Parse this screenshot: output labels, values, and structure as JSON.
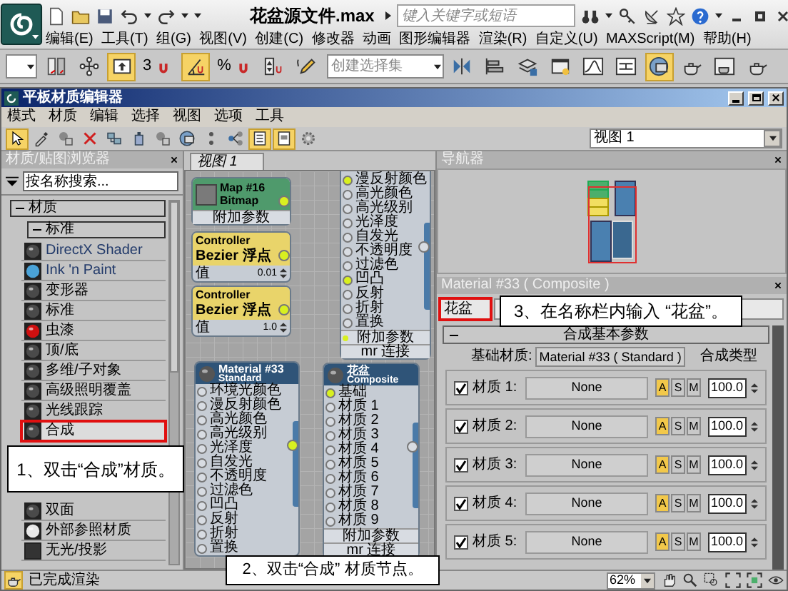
{
  "app_window": {
    "title": "花盆源文件.max",
    "search": {
      "placeholder": "键入关键字或短语"
    }
  },
  "menu": [
    "编辑(E)",
    "工具(T)",
    "组(G)",
    "视图(V)",
    "创建(C)",
    "修改器",
    "动画",
    "图形编辑器",
    "渲染(R)",
    "自定义(U)",
    "MAXScript(M)",
    "帮助(H)"
  ],
  "main_toolbar": {
    "buttons_left": [
      {
        "on": false
      },
      {
        "on": false
      },
      {
        "on": true
      },
      {
        "label": "3",
        "on": false
      },
      {
        "on": true
      },
      {
        "label": "%",
        "on": false
      },
      {
        "on": false
      },
      {
        "on": false
      }
    ],
    "selection_set": {
      "placeholder": "创建选择集"
    },
    "buttons_right": [
      {
        "on": false
      },
      {
        "on": false
      },
      {
        "on": false
      },
      {
        "on": false
      },
      {
        "on": false
      },
      {
        "on": false
      },
      {
        "on": true
      },
      {
        "on": false
      },
      {
        "on": false
      },
      {
        "on": false
      }
    ]
  },
  "editor": {
    "title": "平板材质编辑器",
    "menu": [
      "模式",
      "材质",
      "编辑",
      "选择",
      "视图",
      "选项",
      "工具"
    ],
    "toolbar": [
      {
        "on": true
      },
      {
        "on": false
      },
      {
        "on": false
      },
      {
        "on": false
      },
      {
        "on": false
      },
      {
        "on": false
      },
      {
        "on": false
      },
      {
        "on": false
      },
      {
        "on": false
      },
      {
        "on": false
      },
      {
        "on": true
      },
      {
        "on": true
      },
      {
        "on": false
      }
    ],
    "view_select": {
      "value": "视图 1"
    }
  },
  "browser": {
    "title": "材质/贴图浏览器",
    "search": {
      "placeholder": "按名称搜索..."
    },
    "group": {
      "label": "材质",
      "expanded": true
    },
    "subgroup": {
      "label": "标准",
      "expanded": true
    },
    "items": [
      {
        "label": "DirectX Shader",
        "kind": "sphere",
        "color": "#4a4a4a",
        "selected": false
      },
      {
        "label": "Ink 'n Paint",
        "kind": "disc",
        "color": "#4aa3d8",
        "selected": false
      },
      {
        "label": "变形器",
        "kind": "sphere",
        "color": "#4a4a4a",
        "selected": false
      },
      {
        "label": "标准",
        "kind": "sphere",
        "color": "#4a4a4a",
        "selected": false
      },
      {
        "label": "虫漆",
        "kind": "sphere",
        "color": "#d01010",
        "selected": false
      },
      {
        "label": "顶/底",
        "kind": "sphere",
        "color": "#4a4a4a",
        "selected": false
      },
      {
        "label": "多维/子对象",
        "kind": "sphere",
        "color": "#4a4a4a",
        "selected": false
      },
      {
        "label": "高级照明覆盖",
        "kind": "sphere",
        "color": "#4a4a4a",
        "selected": false
      },
      {
        "label": "光线跟踪",
        "kind": "sphere",
        "color": "#4a4a4a",
        "selected": false
      },
      {
        "label": "合成",
        "kind": "sphere",
        "color": "#4a4a4a",
        "selected": true
      },
      {
        "label": "双面",
        "kind": "sphere",
        "color": "#4a4a4a",
        "selected": false
      },
      {
        "label": "外部参照材质",
        "kind": "sphere",
        "color": "#e8e8e8",
        "selected": false
      },
      {
        "label": "无光/投影",
        "kind": "flat",
        "color": "#333333",
        "selected": false
      }
    ]
  },
  "viewport": {
    "tab": {
      "label": "视图 1",
      "selected": true
    },
    "nodes": [
      {
        "kind": "map",
        "title": "Map #16",
        "subtitle": "Bitmap",
        "footers": [
          "附加参数"
        ]
      },
      {
        "kind": "controller",
        "title": "Controller",
        "subtitle": "Bezier 浮点",
        "value": {
          "label": "值",
          "reading": "0.01"
        }
      },
      {
        "kind": "controller",
        "title": "Controller",
        "subtitle": "Bezier 浮点",
        "value": {
          "label": "值",
          "reading": "1.0"
        }
      },
      {
        "kind": "material",
        "slots": [
          "漫反射颜色",
          "高光颜色",
          "高光级别",
          "光泽度",
          "自发光",
          "不透明度",
          "过滤色",
          "凹凸",
          "反射",
          "折射",
          "置换"
        ],
        "footers": [
          "附加参数",
          "mr 连接"
        ]
      },
      {
        "kind": "material",
        "title": "Material #33",
        "subtitle": "Standard",
        "slots": [
          "环境光颜色",
          "漫反射颜色",
          "高光颜色",
          "高光级别",
          "光泽度",
          "自发光",
          "不透明度",
          "过滤色",
          "凹凸",
          "反射",
          "折射",
          "置换"
        ]
      },
      {
        "kind": "material",
        "title": "花盆",
        "subtitle": "Composite",
        "slots": [
          "基础",
          "材质 1",
          "材质 2",
          "材质 3",
          "材质 4",
          "材质 5",
          "材质 6",
          "材质 7",
          "材质 8",
          "材质 9"
        ],
        "footers": [
          "附加参数",
          "mr 连接"
        ]
      }
    ]
  },
  "navigator": {
    "title": "导航器"
  },
  "params": {
    "title": "Material #33 ( Composite )",
    "name": {
      "value": "花盆",
      "highlighted": true
    },
    "rollout": {
      "label": "合成基本参数",
      "expanded": true
    },
    "base": {
      "label": "基础材质:",
      "value": "Material #33 ( Standard )"
    },
    "composite_type_label": "合成类型",
    "rows": [
      {
        "enabled": true,
        "label": "材质 1:",
        "map": "None",
        "modes": [
          {
            "label": "A",
            "on": true
          },
          {
            "label": "S",
            "on": false
          },
          {
            "label": "M",
            "on": false
          }
        ],
        "amount": "100.0"
      },
      {
        "enabled": true,
        "label": "材质 2:",
        "map": "None",
        "modes": [
          {
            "label": "A",
            "on": true
          },
          {
            "label": "S",
            "on": false
          },
          {
            "label": "M",
            "on": false
          }
        ],
        "amount": "100.0"
      },
      {
        "enabled": true,
        "label": "材质 3:",
        "map": "None",
        "modes": [
          {
            "label": "A",
            "on": true
          },
          {
            "label": "S",
            "on": false
          },
          {
            "label": "M",
            "on": false
          }
        ],
        "amount": "100.0"
      },
      {
        "enabled": true,
        "label": "材质 4:",
        "map": "None",
        "modes": [
          {
            "label": "A",
            "on": true
          },
          {
            "label": "S",
            "on": false
          },
          {
            "label": "M",
            "on": false
          }
        ],
        "amount": "100.0"
      },
      {
        "enabled": true,
        "label": "材质 5:",
        "map": "None",
        "modes": [
          {
            "label": "A",
            "on": true
          },
          {
            "label": "S",
            "on": false
          },
          {
            "label": "M",
            "on": false
          }
        ],
        "amount": "100.0"
      }
    ]
  },
  "status": {
    "text": "已完成渲染",
    "zoom": "62%"
  },
  "callouts": [
    {
      "text": "1、双击“合成”材质。"
    },
    {
      "text": "2、双击“合成” 材质节点。"
    },
    {
      "text": "3、在名称栏内输入 “花盆”。"
    }
  ]
}
